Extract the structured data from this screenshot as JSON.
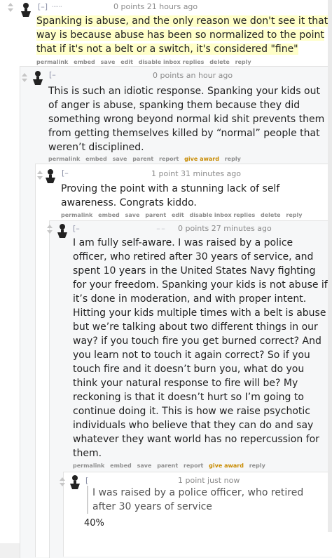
{
  "comments": [
    {
      "collapse": "[–]",
      "username": " ······",
      "meta": "0 points 21 hours ago",
      "body": "Spanking is abuse, and the only reason we don't see it that way is because abuse has been so normalized to the point that if it's not a belt or a switch, it's considered \"fine\"",
      "actions": [
        "permalink",
        "embed",
        "save",
        "edit",
        "disable inbox replies",
        "delete",
        "reply"
      ]
    },
    {
      "collapse": "[–",
      "username": "",
      "meta": "0 points an hour ago",
      "body": "This is such an idiotic response. Spanking your kids out of anger is abuse, spanking them because they did something wrong beyond normal kid shit prevents them from getting themselves killed by “normal” people that weren’t disciplined.",
      "actions": [
        "permalink",
        "embed",
        "save",
        "parent",
        "report",
        "give award",
        "reply"
      ]
    },
    {
      "collapse": "[–",
      "username": "",
      "meta": "1 point 31 minutes ago",
      "body": "Proving the point with a stunning lack of self awareness. Congrats kiddo.",
      "actions": [
        "permalink",
        "embed",
        "save",
        "parent",
        "edit",
        "disable inbox replies",
        "delete",
        "reply"
      ]
    },
    {
      "collapse": "[–",
      "username": " – –",
      "meta": "0 points 27 minutes ago",
      "body": "I am fully self-aware. I was raised by a police officer, who retired after 30 years of service, and spent 10 years in the United States Navy fighting for your freedom. Spanking your kids is not abuse if it’s done in moderation, and with proper intent. Hitting your kids multiple times with a belt is abuse but we’re talking about two different things in our way? if you touch fire you get burned correct? And you learn not to touch it again correct? So if you touch fire and it doesn’t burn you, what do you think your natural response to fire will be? My reckoning is that it doesn’t hurt so I’m going to continue doing it. This is how we raise psychotic individuals who believe that they can do and say whatever they want world has no repercussion for them.",
      "actions": [
        "permalink",
        "embed",
        "save",
        "parent",
        "report",
        "give award",
        "reply"
      ]
    },
    {
      "collapse": "[",
      "username": "",
      "meta": "1 point just now",
      "quote": "I was raised by a police officer, who retired after 30 years of service",
      "extra": "40%"
    }
  ]
}
